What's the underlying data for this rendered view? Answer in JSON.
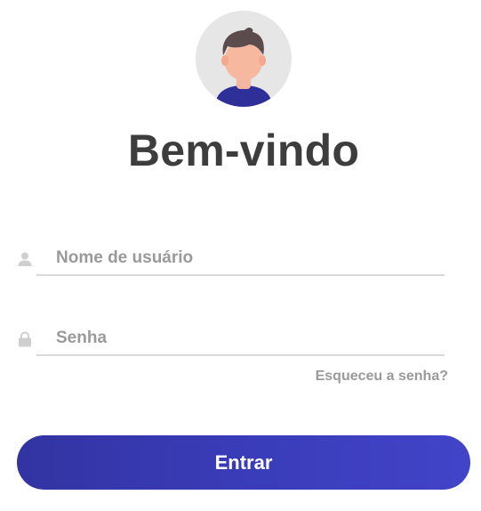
{
  "header": {
    "title": "Bem-vindo",
    "avatar_icon": "user-avatar-icon"
  },
  "form": {
    "username": {
      "placeholder": "Nome de usuário",
      "value": "",
      "icon": "user-icon"
    },
    "password": {
      "placeholder": "Senha",
      "value": "",
      "icon": "lock-icon"
    },
    "forgot_label": "Esqueceu a senha?",
    "submit_label": "Entrar"
  },
  "colors": {
    "accent": "#3a3dba",
    "title": "#3d3d3d",
    "muted": "#9a9a9a",
    "avatar_bg": "#e6e6e6"
  }
}
